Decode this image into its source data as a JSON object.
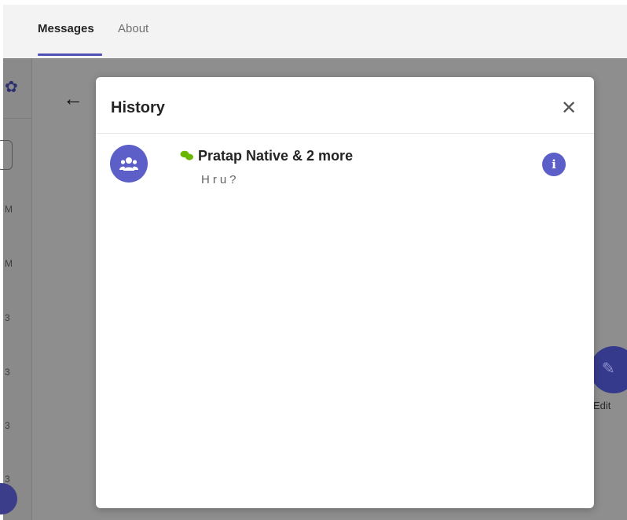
{
  "tabs": [
    {
      "label": "Messages",
      "active": true
    },
    {
      "label": "About",
      "active": false
    }
  ],
  "background": {
    "rail_texts": [
      "M",
      "M",
      "3",
      "3",
      "3",
      "3"
    ],
    "fab_label": "Edit"
  },
  "dialog": {
    "title": "History",
    "close_icon": "close-icon",
    "items": [
      {
        "title": "Pratap Native & 2 more",
        "preview": "Hru?",
        "avatar_icon": "group-icon",
        "type_icon": "chat-bubbles-icon",
        "info_label": "i"
      }
    ]
  },
  "colors": {
    "accent": "#5b5fc7",
    "chat_green": "#6bb700",
    "overlay": "#8e8e8e"
  }
}
